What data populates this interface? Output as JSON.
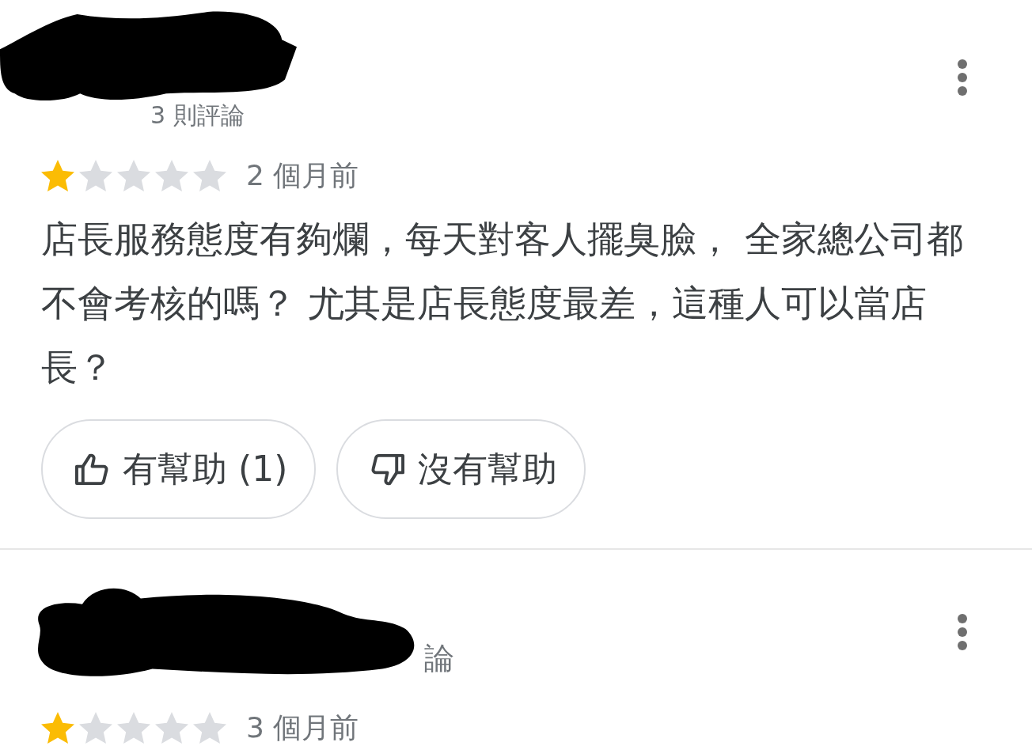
{
  "reviews": [
    {
      "author_redacted": true,
      "subtitle": "3 則評論",
      "stars": 1,
      "date": "2 個月前",
      "text": "店長服務態度有夠爛，每天對客人擺臭臉， 全家總公司都不會考核的嗎？ 尤其是店長態度最差，這種人可以當店長？",
      "buttons": [
        {
          "kind": "helpful",
          "label": "有幫助 (1)"
        },
        {
          "kind": "not_helpful",
          "label": "沒有幫助"
        }
      ]
    },
    {
      "author_redacted": true,
      "subtitle": "論",
      "stars": 1,
      "date": "3 個月前"
    }
  ]
}
